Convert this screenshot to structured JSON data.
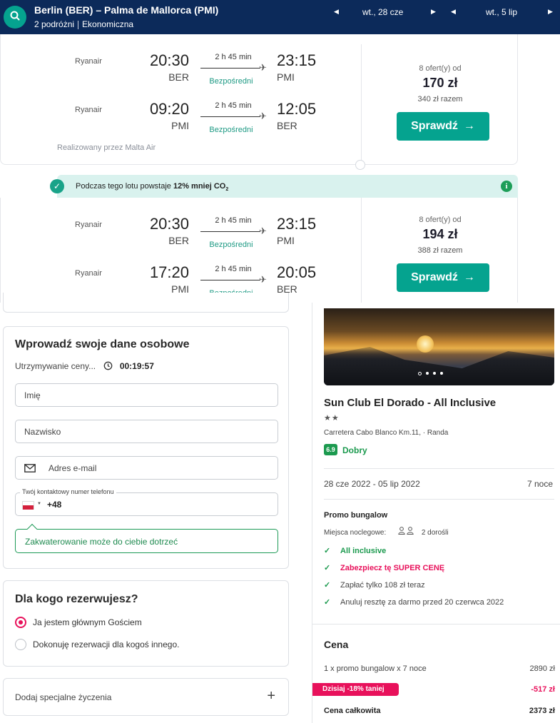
{
  "colors": {
    "header_bg": "#0c2a5a",
    "accent_teal": "#05a38f",
    "promo_pink": "#e8115b",
    "green": "#1c9a4f"
  },
  "header": {
    "route": "Berlin (BER) – Palma de Mallorca (PMI)",
    "travelers": "2 podróżni",
    "cabin": "Ekonomiczna",
    "depart_date": "wt., 28 cze",
    "return_date": "wt., 5 lip",
    "search_icon": "search-icon"
  },
  "flights": [
    {
      "legs": [
        {
          "airline": "Ryanair",
          "dep_time": "20:30",
          "dep_airport": "BER",
          "duration": "2 h 45 min",
          "stops": "Bezpośredni",
          "arr_time": "23:15",
          "arr_airport": "PMI"
        },
        {
          "airline": "Ryanair",
          "dep_time": "09:20",
          "dep_airport": "PMI",
          "duration": "2 h 45 min",
          "stops": "Bezpośredni",
          "arr_time": "12:05",
          "arr_airport": "BER"
        }
      ],
      "offers": "8 ofert(y) od",
      "price": "170 zł",
      "total": "340 zł razem",
      "button": "Sprawdź",
      "operated_by": "Realizowany przez Malta Air"
    },
    {
      "co2_prefix": "Podczas tego lotu powstaje ",
      "co2_bold": "12% mniej CO",
      "co2_sub": "2",
      "legs": [
        {
          "airline": "Ryanair",
          "dep_time": "20:30",
          "dep_airport": "BER",
          "duration": "2 h 45 min",
          "stops": "Bezpośredni",
          "arr_time": "23:15",
          "arr_airport": "PMI"
        },
        {
          "airline": "Ryanair",
          "dep_time": "17:20",
          "dep_airport": "PMI",
          "duration": "2 h 45 min",
          "stops": "Bezpośredni",
          "arr_time": "20:05",
          "arr_airport": "BER"
        }
      ],
      "offers": "8 ofert(y) od",
      "price": "194 zł",
      "total": "388 zł razem",
      "button": "Sprawdź"
    }
  ],
  "personal": {
    "title": "Wprowadź swoje dane osobowe",
    "hold_label": "Utrzymywanie ceny...",
    "hold_timer": "00:19:57",
    "first_name_placeholder": "Imię",
    "last_name_placeholder": "Nazwisko",
    "email_placeholder": "Adres e-mail",
    "phone_label": "Twój kontaktowy numer telefonu",
    "phone_code": "+48",
    "note": "Zakwaterowanie może do ciebie dotrzeć"
  },
  "booking_for": {
    "title": "Dla kogo rezerwujesz?",
    "option_self": "Ja jestem głównym Gościem",
    "option_other": "Dokonuję rezerwacji dla kogoś innego."
  },
  "special_requests": {
    "label": "Dodaj specjalne życzenia",
    "icon": "+"
  },
  "hotel": {
    "name": "Sun Club El Dorado - All Inclusive",
    "stars": "★★",
    "address": "Carretera Cabo Blanco Km.11, · Randa",
    "score": "6.9",
    "score_label": "Dobry",
    "dates": "28 cze 2022 - 05 lip 2022",
    "nights": "7 noce",
    "room": "Promo bungalow",
    "beds_label": "Miejsca noclegowe:",
    "beds_value": "2 dorośli",
    "features": [
      {
        "text": "All inclusive",
        "style": "green"
      },
      {
        "text": "Zabezpiecz tę SUPER CENĘ",
        "style": "pink"
      },
      {
        "text": "Zapłać tylko 108 zł teraz",
        "style": "plain"
      },
      {
        "text": "Anuluj resztę za darmo przed 20 czerwca 2022",
        "style": "plain"
      }
    ]
  },
  "price": {
    "title": "Cena",
    "item": "1 x promo bungalow  x 7 noce",
    "item_amount": "2890 zł",
    "discount_label": "Dzisiaj -18% taniej",
    "discount_amount": "-517 zł",
    "total_label": "Cena całkowita",
    "total_amount": "2373 zł"
  }
}
